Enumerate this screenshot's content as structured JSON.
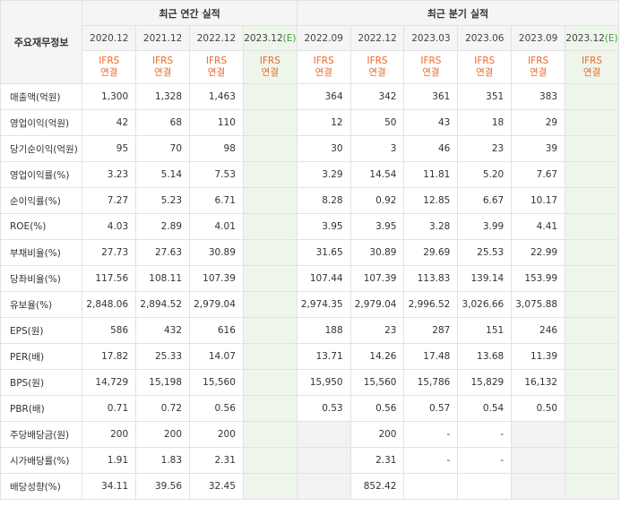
{
  "header": {
    "corner_label": "주요재무정보",
    "annual_title": "최근 연간 실적",
    "quarter_title": "최근 분기 실적"
  },
  "periods": {
    "annual": [
      "2020.12",
      "2021.12",
      "2022.12",
      "2023.12"
    ],
    "quarter": [
      "2022.09",
      "2022.12",
      "2023.03",
      "2023.06",
      "2023.09",
      "2023.12"
    ],
    "estimate_mark": "(E)"
  },
  "basis": {
    "line1": "IFRS",
    "line2": "연결"
  },
  "rows": [
    {
      "label": "매출액(억원)",
      "annual": [
        "1,300",
        "1,328",
        "1,463",
        ""
      ],
      "quarter": [
        "364",
        "342",
        "361",
        "351",
        "383",
        ""
      ]
    },
    {
      "label": "영업이익(억원)",
      "annual": [
        "42",
        "68",
        "110",
        ""
      ],
      "quarter": [
        "12",
        "50",
        "43",
        "18",
        "29",
        ""
      ]
    },
    {
      "label": "당기순이익(억원)",
      "annual": [
        "95",
        "70",
        "98",
        ""
      ],
      "quarter": [
        "30",
        "3",
        "46",
        "23",
        "39",
        ""
      ]
    },
    {
      "label": "영업이익률(%)",
      "annual": [
        "3.23",
        "5.14",
        "7.53",
        ""
      ],
      "quarter": [
        "3.29",
        "14.54",
        "11.81",
        "5.20",
        "7.67",
        ""
      ]
    },
    {
      "label": "순이익률(%)",
      "annual": [
        "7.27",
        "5.23",
        "6.71",
        ""
      ],
      "quarter": [
        "8.28",
        "0.92",
        "12.85",
        "6.67",
        "10.17",
        ""
      ]
    },
    {
      "label": "ROE(%)",
      "annual": [
        "4.03",
        "2.89",
        "4.01",
        ""
      ],
      "quarter": [
        "3.95",
        "3.95",
        "3.28",
        "3.99",
        "4.41",
        ""
      ]
    },
    {
      "label": "부채비율(%)",
      "annual": [
        "27.73",
        "27.63",
        "30.89",
        ""
      ],
      "quarter": [
        "31.65",
        "30.89",
        "29.69",
        "25.53",
        "22.99",
        ""
      ]
    },
    {
      "label": "당좌비율(%)",
      "annual": [
        "117.56",
        "108.11",
        "107.39",
        ""
      ],
      "quarter": [
        "107.44",
        "107.39",
        "113.83",
        "139.14",
        "153.99",
        ""
      ]
    },
    {
      "label": "유보율(%)",
      "annual": [
        "2,848.06",
        "2,894.52",
        "2,979.04",
        ""
      ],
      "quarter": [
        "2,974.35",
        "2,979.04",
        "2,996.52",
        "3,026.66",
        "3,075.88",
        ""
      ]
    },
    {
      "label": "EPS(원)",
      "annual": [
        "586",
        "432",
        "616",
        ""
      ],
      "quarter": [
        "188",
        "23",
        "287",
        "151",
        "246",
        ""
      ]
    },
    {
      "label": "PER(배)",
      "annual": [
        "17.82",
        "25.33",
        "14.07",
        ""
      ],
      "quarter": [
        "13.71",
        "14.26",
        "17.48",
        "13.68",
        "11.39",
        ""
      ]
    },
    {
      "label": "BPS(원)",
      "annual": [
        "14,729",
        "15,198",
        "15,560",
        ""
      ],
      "quarter": [
        "15,950",
        "15,560",
        "15,786",
        "15,829",
        "16,132",
        ""
      ]
    },
    {
      "label": "PBR(배)",
      "annual": [
        "0.71",
        "0.72",
        "0.56",
        ""
      ],
      "quarter": [
        "0.53",
        "0.56",
        "0.57",
        "0.54",
        "0.50",
        ""
      ]
    },
    {
      "label": "주당배당금(원)",
      "annual": [
        "200",
        "200",
        "200",
        ""
      ],
      "quarter": [
        "",
        "200",
        "-",
        "-",
        "",
        ""
      ]
    },
    {
      "label": "시가배당률(%)",
      "annual": [
        "1.91",
        "1.83",
        "2.31",
        ""
      ],
      "quarter": [
        "",
        "2.31",
        "-",
        "-",
        "",
        ""
      ]
    },
    {
      "label": "배당성향(%)",
      "annual": [
        "34.11",
        "39.56",
        "32.45",
        ""
      ],
      "quarter": [
        "",
        "852.42",
        "",
        "",
        "",
        ""
      ]
    }
  ],
  "colors": {
    "estimate_bg": "#eef6ec",
    "estimate_text": "#4a9a3e",
    "ifrs_text": "#f26722",
    "header_bg": "#f5f5f5"
  }
}
